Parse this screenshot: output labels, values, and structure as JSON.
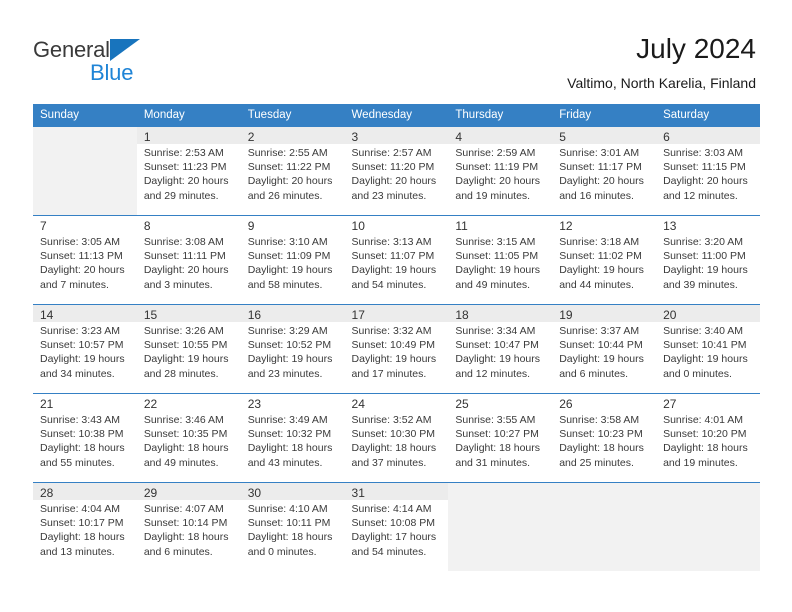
{
  "brand": {
    "name_top": "General",
    "name_bottom": "Blue",
    "triangle_color": "#1874bd",
    "blue_color": "#1f84d6"
  },
  "header": {
    "title": "July 2024",
    "subtitle": "Valtimo, North Karelia, Finland"
  },
  "theme": {
    "header_bg": "#3580c4",
    "alt_row_bg": "#f2f2f2",
    "text": "#3a3a3a"
  },
  "weekdays": [
    "Sunday",
    "Monday",
    "Tuesday",
    "Wednesday",
    "Thursday",
    "Friday",
    "Saturday"
  ],
  "weeks": [
    [
      {
        "day": "",
        "lines": []
      },
      {
        "day": "1",
        "lines": [
          "Sunrise: 2:53 AM",
          "Sunset: 11:23 PM",
          "Daylight: 20 hours",
          "and 29 minutes."
        ]
      },
      {
        "day": "2",
        "lines": [
          "Sunrise: 2:55 AM",
          "Sunset: 11:22 PM",
          "Daylight: 20 hours",
          "and 26 minutes."
        ]
      },
      {
        "day": "3",
        "lines": [
          "Sunrise: 2:57 AM",
          "Sunset: 11:20 PM",
          "Daylight: 20 hours",
          "and 23 minutes."
        ]
      },
      {
        "day": "4",
        "lines": [
          "Sunrise: 2:59 AM",
          "Sunset: 11:19 PM",
          "Daylight: 20 hours",
          "and 19 minutes."
        ]
      },
      {
        "day": "5",
        "lines": [
          "Sunrise: 3:01 AM",
          "Sunset: 11:17 PM",
          "Daylight: 20 hours",
          "and 16 minutes."
        ]
      },
      {
        "day": "6",
        "lines": [
          "Sunrise: 3:03 AM",
          "Sunset: 11:15 PM",
          "Daylight: 20 hours",
          "and 12 minutes."
        ]
      }
    ],
    [
      {
        "day": "7",
        "lines": [
          "Sunrise: 3:05 AM",
          "Sunset: 11:13 PM",
          "Daylight: 20 hours",
          "and 7 minutes."
        ]
      },
      {
        "day": "8",
        "lines": [
          "Sunrise: 3:08 AM",
          "Sunset: 11:11 PM",
          "Daylight: 20 hours",
          "and 3 minutes."
        ]
      },
      {
        "day": "9",
        "lines": [
          "Sunrise: 3:10 AM",
          "Sunset: 11:09 PM",
          "Daylight: 19 hours",
          "and 58 minutes."
        ]
      },
      {
        "day": "10",
        "lines": [
          "Sunrise: 3:13 AM",
          "Sunset: 11:07 PM",
          "Daylight: 19 hours",
          "and 54 minutes."
        ]
      },
      {
        "day": "11",
        "lines": [
          "Sunrise: 3:15 AM",
          "Sunset: 11:05 PM",
          "Daylight: 19 hours",
          "and 49 minutes."
        ]
      },
      {
        "day": "12",
        "lines": [
          "Sunrise: 3:18 AM",
          "Sunset: 11:02 PM",
          "Daylight: 19 hours",
          "and 44 minutes."
        ]
      },
      {
        "day": "13",
        "lines": [
          "Sunrise: 3:20 AM",
          "Sunset: 11:00 PM",
          "Daylight: 19 hours",
          "and 39 minutes."
        ]
      }
    ],
    [
      {
        "day": "14",
        "lines": [
          "Sunrise: 3:23 AM",
          "Sunset: 10:57 PM",
          "Daylight: 19 hours",
          "and 34 minutes."
        ]
      },
      {
        "day": "15",
        "lines": [
          "Sunrise: 3:26 AM",
          "Sunset: 10:55 PM",
          "Daylight: 19 hours",
          "and 28 minutes."
        ]
      },
      {
        "day": "16",
        "lines": [
          "Sunrise: 3:29 AM",
          "Sunset: 10:52 PM",
          "Daylight: 19 hours",
          "and 23 minutes."
        ]
      },
      {
        "day": "17",
        "lines": [
          "Sunrise: 3:32 AM",
          "Sunset: 10:49 PM",
          "Daylight: 19 hours",
          "and 17 minutes."
        ]
      },
      {
        "day": "18",
        "lines": [
          "Sunrise: 3:34 AM",
          "Sunset: 10:47 PM",
          "Daylight: 19 hours",
          "and 12 minutes."
        ]
      },
      {
        "day": "19",
        "lines": [
          "Sunrise: 3:37 AM",
          "Sunset: 10:44 PM",
          "Daylight: 19 hours",
          "and 6 minutes."
        ]
      },
      {
        "day": "20",
        "lines": [
          "Sunrise: 3:40 AM",
          "Sunset: 10:41 PM",
          "Daylight: 19 hours",
          "and 0 minutes."
        ]
      }
    ],
    [
      {
        "day": "21",
        "lines": [
          "Sunrise: 3:43 AM",
          "Sunset: 10:38 PM",
          "Daylight: 18 hours",
          "and 55 minutes."
        ]
      },
      {
        "day": "22",
        "lines": [
          "Sunrise: 3:46 AM",
          "Sunset: 10:35 PM",
          "Daylight: 18 hours",
          "and 49 minutes."
        ]
      },
      {
        "day": "23",
        "lines": [
          "Sunrise: 3:49 AM",
          "Sunset: 10:32 PM",
          "Daylight: 18 hours",
          "and 43 minutes."
        ]
      },
      {
        "day": "24",
        "lines": [
          "Sunrise: 3:52 AM",
          "Sunset: 10:30 PM",
          "Daylight: 18 hours",
          "and 37 minutes."
        ]
      },
      {
        "day": "25",
        "lines": [
          "Sunrise: 3:55 AM",
          "Sunset: 10:27 PM",
          "Daylight: 18 hours",
          "and 31 minutes."
        ]
      },
      {
        "day": "26",
        "lines": [
          "Sunrise: 3:58 AM",
          "Sunset: 10:23 PM",
          "Daylight: 18 hours",
          "and 25 minutes."
        ]
      },
      {
        "day": "27",
        "lines": [
          "Sunrise: 4:01 AM",
          "Sunset: 10:20 PM",
          "Daylight: 18 hours",
          "and 19 minutes."
        ]
      }
    ],
    [
      {
        "day": "28",
        "lines": [
          "Sunrise: 4:04 AM",
          "Sunset: 10:17 PM",
          "Daylight: 18 hours",
          "and 13 minutes."
        ]
      },
      {
        "day": "29",
        "lines": [
          "Sunrise: 4:07 AM",
          "Sunset: 10:14 PM",
          "Daylight: 18 hours",
          "and 6 minutes."
        ]
      },
      {
        "day": "30",
        "lines": [
          "Sunrise: 4:10 AM",
          "Sunset: 10:11 PM",
          "Daylight: 18 hours",
          "and 0 minutes."
        ]
      },
      {
        "day": "31",
        "lines": [
          "Sunrise: 4:14 AM",
          "Sunset: 10:08 PM",
          "Daylight: 17 hours",
          "and 54 minutes."
        ]
      },
      {
        "day": "",
        "lines": []
      },
      {
        "day": "",
        "lines": []
      },
      {
        "day": "",
        "lines": []
      }
    ]
  ]
}
